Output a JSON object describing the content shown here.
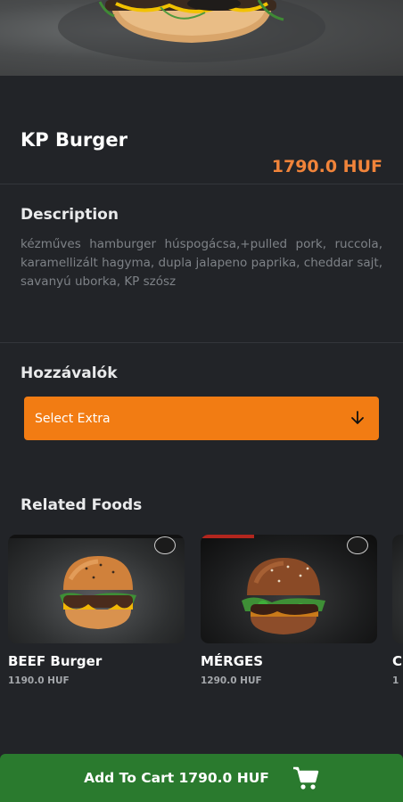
{
  "product": {
    "name": "KP Burger",
    "price": "1790.0 HUF"
  },
  "description": {
    "title": "Description",
    "text": "kézműves hamburger húspogácsa,+pulled pork, ruccola, karamellizált hagyma, dupla jalapeno paprika, cheddar sajt, savanyú uborka, KP szósz"
  },
  "extras": {
    "title": "Hozzávalók",
    "select_label": "Select Extra",
    "icon": "arrow-down-icon"
  },
  "related": {
    "title": "Related Foods",
    "items": [
      {
        "name": "BEEF Burger",
        "price": "1190.0 HUF"
      },
      {
        "name": "MÉRGES",
        "price": "1290.0 HUF"
      },
      {
        "name": "C",
        "price": "1"
      }
    ]
  },
  "cart": {
    "label": "Add To Cart 1790.0 HUF",
    "icon": "shopping-cart-icon"
  },
  "colors": {
    "background": "#222428",
    "accent_orange": "#f27c13",
    "price_orange": "#f1843a",
    "cart_green": "#2a7a2e"
  }
}
